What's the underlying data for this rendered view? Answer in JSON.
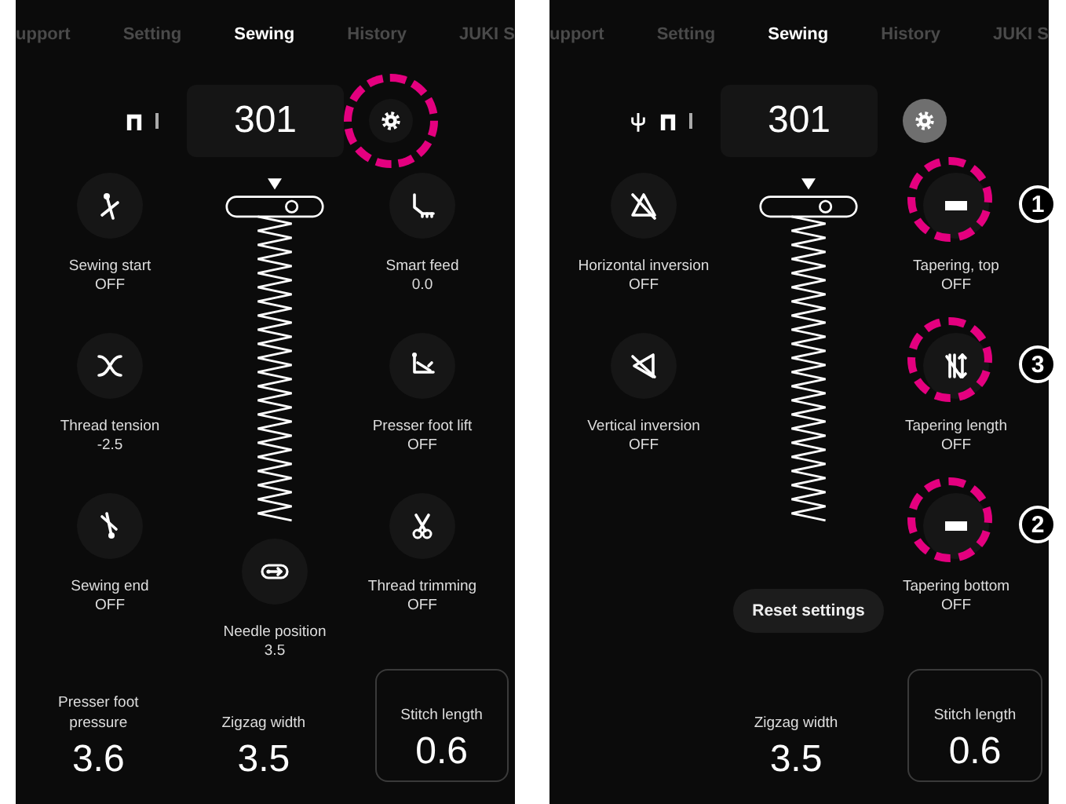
{
  "screens": [
    {
      "tabs": [
        {
          "label": "upport",
          "selected": false
        },
        {
          "label": "Setting",
          "selected": false
        },
        {
          "label": "Sewing",
          "selected": true
        },
        {
          "label": "History",
          "selected": false
        },
        {
          "label": "JUKI S",
          "selected": false
        }
      ],
      "usb_shown": false,
      "pattern_number": "301",
      "settings_button": {
        "selected": false,
        "circled": true
      },
      "left_items": [
        {
          "kind": "sewing-start",
          "label": "Sewing start",
          "value": "OFF"
        },
        {
          "kind": "thread-tension",
          "label": "Thread tension",
          "value": "-2.5"
        },
        {
          "kind": "sewing-end",
          "label": "Sewing end",
          "value": "OFF"
        }
      ],
      "right_items": [
        {
          "kind": "smart-feed",
          "label": "Smart feed",
          "value": "0.0"
        },
        {
          "kind": "presser-foot-lift",
          "label": "Presser foot lift",
          "value": "OFF"
        },
        {
          "kind": "thread-trimming",
          "label": "Thread trimming",
          "value": "OFF"
        }
      ],
      "center_item": {
        "kind": "needle-position",
        "label": "Needle position",
        "value": "3.5"
      },
      "readouts": [
        {
          "label": "Presser foot pressure",
          "value": "3.6",
          "framed": false
        },
        {
          "label": "Zigzag width",
          "value": "3.5",
          "framed": false
        },
        {
          "label": "Stitch length",
          "value": "0.6",
          "framed": true
        }
      ]
    },
    {
      "tabs": [
        {
          "label": "upport",
          "selected": false
        },
        {
          "label": "Setting",
          "selected": false
        },
        {
          "label": "Sewing",
          "selected": true
        },
        {
          "label": "History",
          "selected": false
        },
        {
          "label": "JUKI S",
          "selected": false
        }
      ],
      "usb_shown": true,
      "pattern_number": "301",
      "settings_button": {
        "selected": true,
        "circled": false
      },
      "left_items": [
        {
          "kind": "horizontal-inversion",
          "label": "Horizontal inversion",
          "value": "OFF"
        },
        {
          "kind": "vertical-inversion",
          "label": "Vertical inversion",
          "value": "OFF"
        }
      ],
      "right_items": [
        {
          "kind": "tapering-top",
          "label": "Tapering, top",
          "value": "OFF",
          "callout": "1"
        },
        {
          "kind": "tapering-length",
          "label": "Tapering length",
          "value": "OFF",
          "callout": "3"
        },
        {
          "kind": "tapering-bottom",
          "label": "Tapering bottom",
          "value": "OFF",
          "callout": "2"
        }
      ],
      "reset_button": {
        "label": "Reset settings"
      },
      "readouts": [
        {
          "label": "Zigzag width",
          "value": "3.5",
          "framed": false
        },
        {
          "label": "Stitch length",
          "value": "0.6",
          "framed": true
        }
      ]
    }
  ]
}
